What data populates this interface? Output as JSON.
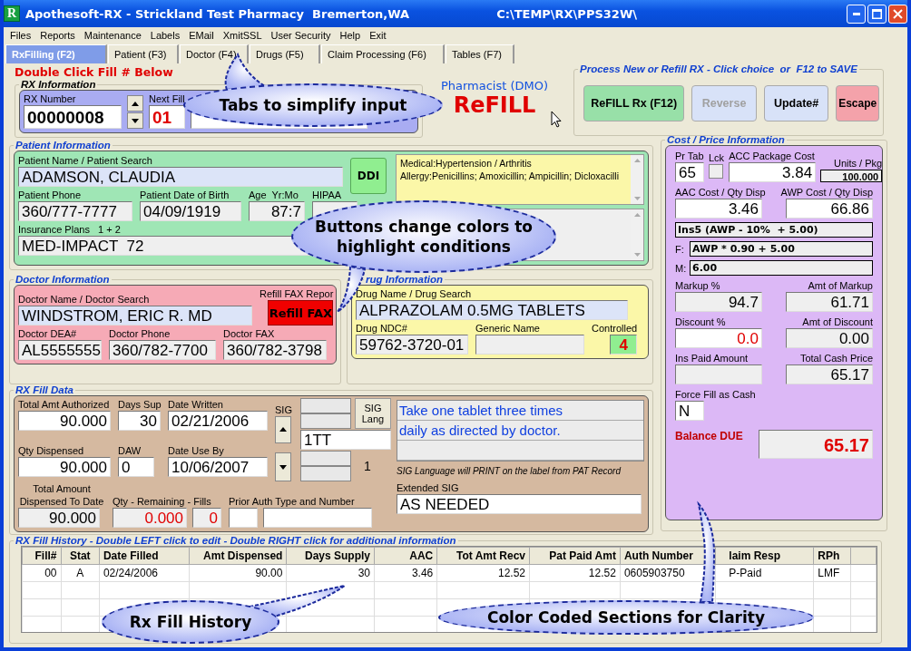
{
  "window": {
    "logo": "R",
    "title": "Apothesoft-RX - Strickland Test Pharmacy  Bremerton,WA",
    "path": "C:\\TEMP\\RX\\PPS32W\\"
  },
  "menu": [
    "Files",
    "Reports",
    "Maintenance",
    "Labels",
    "EMail",
    "XmitSSL",
    "User Security",
    "Help",
    "Exit"
  ],
  "tabs": [
    {
      "label": "RxFilling (F2)",
      "selected": true
    },
    {
      "label": "Patient (F3)",
      "selected": false
    },
    {
      "label": "Doctor (F4)",
      "selected": false
    },
    {
      "label": "Drugs (F5)",
      "selected": false
    },
    {
      "label": "Claim Processing (F6)",
      "selected": false
    },
    {
      "label": "Tables (F7)",
      "selected": false
    }
  ],
  "hint": "Double Click Fill # Below",
  "rx_information": {
    "legend": "RX Information",
    "rx_number": {
      "label": "RX Number",
      "value": "00000008"
    },
    "next_fill": {
      "label": "Next Fill",
      "value": "01"
    }
  },
  "pharmacist": "Pharmacist (DMO)",
  "mode": "ReFILL",
  "process": {
    "legend": "Process New or Refill RX - Click choice  or  F12 to SAVE",
    "buttons": [
      {
        "label": "ReFILL Rx (F12)",
        "color": "#98e0a8",
        "disabled": false
      },
      {
        "label": "Reverse",
        "color": "#d8e2f8",
        "disabled": true
      },
      {
        "label": "Update#",
        "color": "#d8e2f8",
        "disabled": false
      },
      {
        "label": "Escape",
        "color": "#f4a2aa",
        "disabled": false
      }
    ]
  },
  "patient": {
    "legend": "Patient Information",
    "name": {
      "label": "Patient Name / Patient Search",
      "value": "ADAMSON, CLAUDIA"
    },
    "ddi_button": "DDI",
    "notes": [
      "Medical:Hypertension / Arthritis",
      "Allergy:Penicillins; Amoxicillin; Ampicillin; Dicloxacilli"
    ],
    "phone": {
      "label": "Patient Phone",
      "value": "360/777-7777"
    },
    "dob": {
      "label": "Patient Date of Birth",
      "value": "04/09/1919"
    },
    "age": {
      "label": "Age  Yr:Mo",
      "value": "87:7"
    },
    "hipaa": {
      "label": "HIPAA"
    },
    "insurance": {
      "label": "Insurance Plans   1 + 2",
      "value": "MED-IMPACT  72"
    }
  },
  "doctor": {
    "legend": "Doctor Information",
    "name": {
      "label": "Doctor Name / Doctor Search",
      "value": "WINDSTROM, ERIC R. MD"
    },
    "fax_report_label": "Refill FAX Repor",
    "fax_button": "Refill FAX",
    "dea": {
      "label": "Doctor DEA#",
      "value": "AL5555555"
    },
    "phone": {
      "label": "Doctor Phone",
      "value": "360/782-7700"
    },
    "fax": {
      "label": "Doctor FAX",
      "value": "360/782-3798"
    }
  },
  "drug": {
    "legend": "rug Information",
    "name": {
      "label": "Drug Name / Drug Search",
      "value": "ALPRAZOLAM 0.5MG TABLETS"
    },
    "ndc": {
      "label": "Drug NDC#",
      "value": "59762-3720-01"
    },
    "generic": {
      "label": "Generic Name"
    },
    "controlled": {
      "label": "Controlled",
      "value": "4"
    }
  },
  "fill_data": {
    "legend": "RX Fill Data",
    "total_auth": {
      "label": "Total Amt Authorized",
      "value": "90.000"
    },
    "days_sup": {
      "label": "Days Sup",
      "value": "30"
    },
    "date_written": {
      "label": "Date Written",
      "value": "02/21/2006"
    },
    "sig_label": "SIG",
    "qty_disp": {
      "label": "Qty Dispensed",
      "value": "90.000"
    },
    "daw": {
      "label": "DAW",
      "value": "0"
    },
    "use_by": {
      "label": "Date Use By",
      "value": "10/06/2007"
    },
    "sig_code": "1TT",
    "sig_count": "1",
    "sig_lang_button": "SIG Lang",
    "sig_lines": [
      "Take one tablet three times",
      "daily as directed by doctor."
    ],
    "sig_note": "SIG Language will PRINT on the label from PAT Record",
    "dispensed_to_date": {
      "label": "Total Amount Dispensed To Date",
      "value": "90.000"
    },
    "remaining": {
      "label": "Qty - Remaining - Fills",
      "qty": "0.000",
      "fills": "0"
    },
    "prior_auth": {
      "label": "Prior Auth Type and Number"
    },
    "extended_sig": {
      "label": "Extended SIG",
      "value": "AS NEEDED"
    }
  },
  "cost": {
    "legend": "Cost / Price Information",
    "pr_tab": {
      "label": "Pr Tab",
      "value": "65"
    },
    "lck": {
      "label": "Lck",
      "checked": false
    },
    "acc": {
      "label": "ACC Package Cost",
      "value": "3.84"
    },
    "units": {
      "label": "Units / Pkg",
      "value": "100.000"
    },
    "aac": {
      "label": "AAC Cost / Qty Disp",
      "value": "3.46"
    },
    "awp": {
      "label": "AWP Cost / Qty Disp",
      "value": "66.86"
    },
    "plan": "Ins5 (AWP - 10%  + 5.00)",
    "formula": {
      "label": "F:",
      "value": "AWP * 0.90 + 5.00"
    },
    "minimum": {
      "label": "M:",
      "value": "6.00"
    },
    "markup_pct": {
      "label": "Markup %",
      "value": "94.7"
    },
    "markup_amt": {
      "label": "Amt of Markup",
      "value": "61.71"
    },
    "discount_pct": {
      "label": "Discount %",
      "value": "0.0"
    },
    "discount_amt": {
      "label": "Amt of Discount",
      "value": "0.00"
    },
    "ins_paid": {
      "label": "Ins Paid Amount"
    },
    "total_cash": {
      "label": "Total Cash Price",
      "value": "65.17"
    },
    "force_cash": {
      "label": "Force Fill as Cash",
      "value": "N"
    },
    "balance": {
      "label": "Balance DUE",
      "value": "65.17"
    }
  },
  "history": {
    "legend": "RX Fill History - Double LEFT click to edit - Double RIGHT click for additional information",
    "columns": [
      "Fill#",
      "Stat",
      "Date Filled",
      "Amt Dispensed",
      "Days Supply",
      "AAC",
      "Tot Amt Recv",
      "Pat Paid Amt",
      "Auth Number",
      "laim Resp",
      "RPh"
    ],
    "rows": [
      [
        "00",
        "A",
        "02/24/2006",
        "90.00",
        "30",
        "3.46",
        "12.52",
        "12.52",
        "0605903750",
        "P-Paid",
        "LMF"
      ]
    ]
  },
  "callouts": [
    "Tabs to simplify input",
    "Buttons change colors to highlight conditions",
    "Rx Fill History",
    "Color Coded Sections for Clarity"
  ]
}
